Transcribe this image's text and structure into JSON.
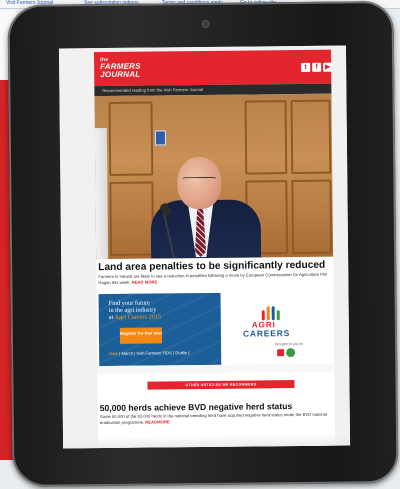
{
  "background_page": {
    "links": [
      "Visit Farmers Journal",
      "See subscription options",
      "Terms and conditions apply",
      "Go to online site"
    ]
  },
  "email": {
    "logo_small": "the",
    "logo_line1": "FARMERS",
    "logo_line2": "JOURNAL",
    "social_icons": [
      "twitter-icon",
      "facebook-icon",
      "youtube-icon"
    ],
    "tagline": "Recommended reading from the Irish Farmers Journal",
    "lead_story": {
      "headline": "Land area penalties to be significantly reduced",
      "summary": "Farmers in Ireland are likely to see a reduction in penalties following a move by European Commissioner for Agriculture Phil Hogan this week.",
      "read_more": "READ MORE"
    },
    "ad": {
      "title_line1": "Find your future",
      "title_line2": "in the agri industry",
      "title_line3": "at",
      "title_accent": "Agri Careers 2015",
      "button": "Register for free now",
      "date_label": "Date",
      "date_text": "| March | Irish Farmers' RDS | Dublin |",
      "logo_agri": "AGRI",
      "logo_careers": "CAREERS",
      "brought_by": "Brought to you by",
      "logo_mark_colors": [
        "#e3262e",
        "#f28a12",
        "#1c5f98",
        "#3c9b3f"
      ]
    },
    "section_label": "OTHER ARTICLES WE RECOMMEND",
    "second_story": {
      "headline": "50,000 herds achieve BVD negative herd status",
      "summary": "Some 50,000 of the 83,000 herds in the national breeding herd have acquired negative herd status under the BVD national eradication programme.",
      "read_more": "READMORE"
    }
  },
  "colors": {
    "brand_red": "#e3262e",
    "ad_blue": "#1c5f98",
    "ad_orange": "#f28a12"
  }
}
